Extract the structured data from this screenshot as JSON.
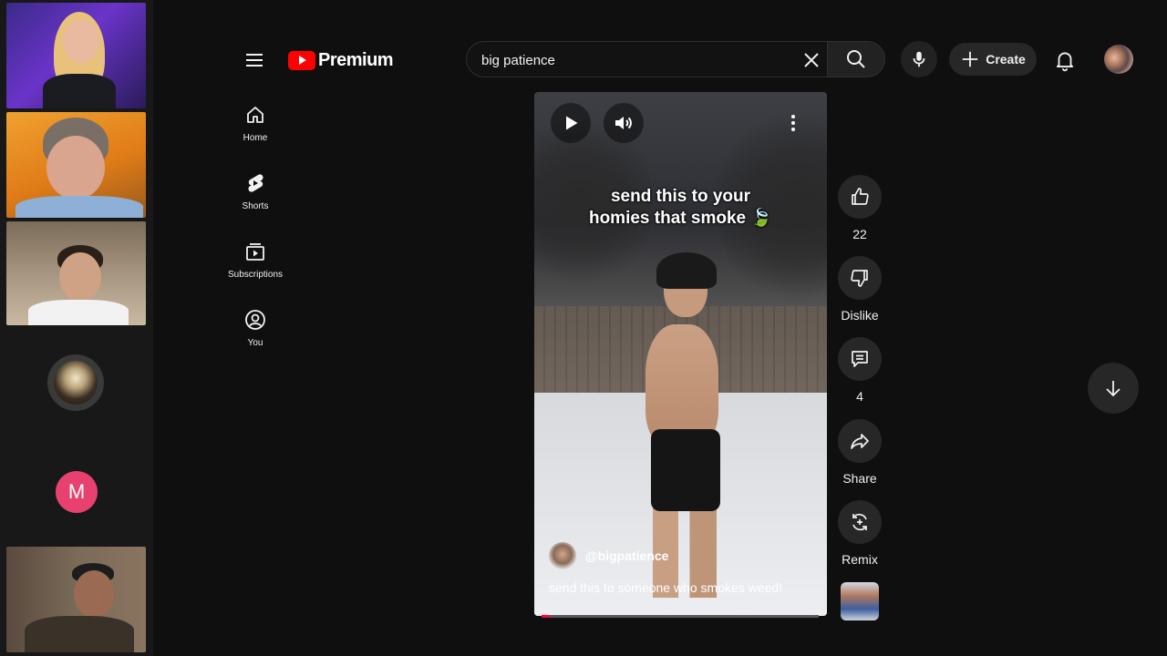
{
  "header": {
    "logo_text": "Premium",
    "search": {
      "value": "big patience"
    },
    "create_label": "Create"
  },
  "sidebar": {
    "items": [
      {
        "label": "Home",
        "icon": "home-icon"
      },
      {
        "label": "Shorts",
        "icon": "shorts-icon"
      },
      {
        "label": "Subscriptions",
        "icon": "subscriptions-icon"
      },
      {
        "label": "You",
        "icon": "you-icon"
      }
    ]
  },
  "call": {
    "participant_initial": "M",
    "participant_color": "#e8416f"
  },
  "short": {
    "overlay_caption_line1": "send this to your",
    "overlay_caption_line2": "homies that smoke 🍃",
    "channel_handle": "@bigpatience",
    "description": "send this to someone who smokes weed!",
    "progress_fraction": 0.03
  },
  "actions": {
    "like_count": "22",
    "dislike_label": "Dislike",
    "comment_count": "4",
    "share_label": "Share",
    "remix_label": "Remix"
  },
  "colors": {
    "background": "#0f0f0f",
    "youtube_red": "#ff0000",
    "button_bg": "#272727",
    "progress_red": "#ff0033"
  }
}
